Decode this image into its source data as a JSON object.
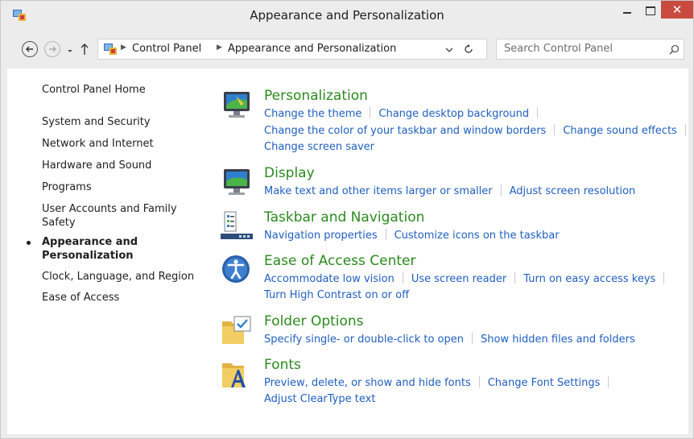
{
  "window": {
    "title": "Appearance and Personalization",
    "close_glyph": "✕",
    "colors": {
      "close": "#c94a3f",
      "category_title": "#2a8a1e",
      "task_link": "#1f5fbf"
    }
  },
  "nav": {
    "breadcrumb": [
      "Control Panel",
      "Appearance and Personalization"
    ],
    "search_placeholder": "Search Control Panel"
  },
  "sidebar": {
    "home": "Control Panel Home",
    "items": [
      "System and Security",
      "Network and Internet",
      "Hardware and Sound",
      "Programs",
      "User Accounts and Family Safety",
      "Appearance and Personalization",
      "Clock, Language, and Region",
      "Ease of Access"
    ],
    "current_index": 5
  },
  "categories": [
    {
      "title": "Personalization",
      "icon": "personalization-icon",
      "links": [
        "Change the theme",
        "Change desktop background",
        "Change the color of your taskbar and window borders",
        "Change sound effects",
        "Change screen saver"
      ]
    },
    {
      "title": "Display",
      "icon": "display-icon",
      "links": [
        "Make text and other items larger or smaller",
        "Adjust screen resolution"
      ]
    },
    {
      "title": "Taskbar and Navigation",
      "icon": "taskbar-icon",
      "links": [
        "Navigation properties",
        "Customize icons on the taskbar"
      ]
    },
    {
      "title": "Ease of Access Center",
      "icon": "ease-of-access-icon",
      "links": [
        "Accommodate low vision",
        "Use screen reader",
        "Turn on easy access keys",
        "Turn High Contrast on or off"
      ]
    },
    {
      "title": "Folder Options",
      "icon": "folder-options-icon",
      "links": [
        "Specify single- or double-click to open",
        "Show hidden files and folders"
      ]
    },
    {
      "title": "Fonts",
      "icon": "fonts-icon",
      "links": [
        "Preview, delete, or show and hide fonts",
        "Change Font Settings",
        "Adjust ClearType text"
      ]
    }
  ]
}
